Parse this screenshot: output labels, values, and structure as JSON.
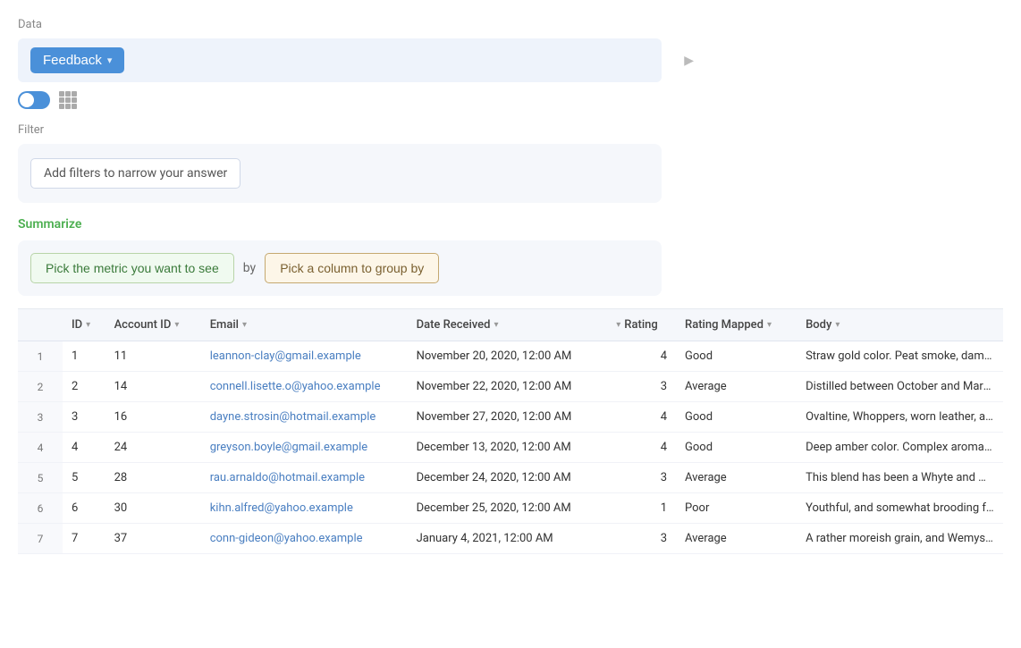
{
  "page": {
    "data_label": "Data",
    "filter_label": "Filter",
    "summarize_label": "Summarize"
  },
  "feedback_btn": {
    "label": "Feedback",
    "chevron": "▾"
  },
  "play_icon": "▶",
  "filter": {
    "placeholder": "Add filters to narrow your answer"
  },
  "summarize": {
    "metric_btn": "Pick the metric you want to see",
    "by_label": "by",
    "group_btn": "Pick a column to group by"
  },
  "table": {
    "columns": [
      {
        "key": "id",
        "label": "ID"
      },
      {
        "key": "account_id",
        "label": "Account ID"
      },
      {
        "key": "email",
        "label": "Email"
      },
      {
        "key": "date_received",
        "label": "Date Received"
      },
      {
        "key": "rating",
        "label": "Rating"
      },
      {
        "key": "rating_mapped",
        "label": "Rating Mapped"
      },
      {
        "key": "body",
        "label": "Body"
      }
    ],
    "rows": [
      {
        "row_num": "1",
        "id": "1",
        "account_id": "11",
        "email": "leannon-clay@gmail.example",
        "date_received": "November 20, 2020, 12:00 AM",
        "rating": "4",
        "rating_mapped": "Good",
        "body": "Straw gold color. Peat smoke, damp earth, sea..."
      },
      {
        "row_num": "2",
        "id": "2",
        "account_id": "14",
        "email": "connell.lisette.o@yahoo.example",
        "date_received": "November 22, 2020, 12:00 AM",
        "rating": "3",
        "rating_mapped": "Average",
        "body": "Distilled between October and March, mature..."
      },
      {
        "row_num": "3",
        "id": "3",
        "account_id": "16",
        "email": "dayne.strosin@hotmail.example",
        "date_received": "November 27, 2020, 12:00 AM",
        "rating": "4",
        "rating_mapped": "Good",
        "body": "Ovaltine, Whoppers, worn leather, antique fur..."
      },
      {
        "row_num": "4",
        "id": "4",
        "account_id": "24",
        "email": "greyson.boyle@gmail.example",
        "date_received": "December 13, 2020, 12:00 AM",
        "rating": "4",
        "rating_mapped": "Good",
        "body": "Deep amber color. Complex aromas of lush fru..."
      },
      {
        "row_num": "5",
        "id": "5",
        "account_id": "28",
        "email": "rau.arnaldo@hotmail.example",
        "date_received": "December 24, 2020, 12:00 AM",
        "rating": "3",
        "rating_mapped": "Average",
        "body": "This blend has been a Whyte and MacKay pie f..."
      },
      {
        "row_num": "6",
        "id": "6",
        "account_id": "30",
        "email": "kihn.alfred@yahoo.example",
        "date_received": "December 25, 2020, 12:00 AM",
        "rating": "1",
        "rating_mapped": "Poor",
        "body": "Youthful, and somewhat brooding for a Tomint..."
      },
      {
        "row_num": "7",
        "id": "7",
        "account_id": "37",
        "email": "conn-gideon@yahoo.example",
        "date_received": "January 4, 2021, 12:00 AM",
        "rating": "3",
        "rating_mapped": "Average",
        "body": "A rather moreish grain, and Wemyss certainly..."
      }
    ]
  }
}
